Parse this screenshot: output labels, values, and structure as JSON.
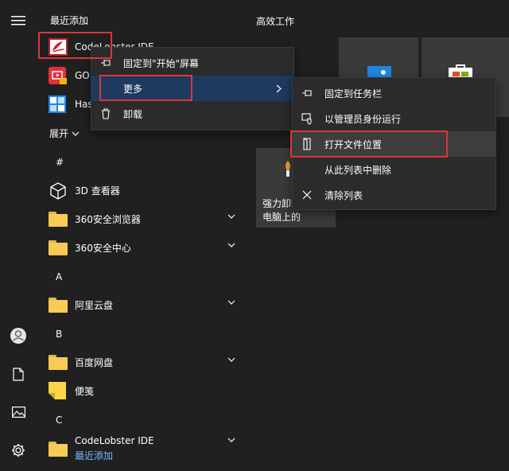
{
  "recent": {
    "title": "最近添加",
    "items": [
      {
        "label": "CodeLobster IDE"
      },
      {
        "label": "GO"
      },
      {
        "label": "Has"
      }
    ]
  },
  "expand_label": "展开",
  "groups": [
    {
      "letter": "#",
      "apps": [
        {
          "label": "3D 查看器"
        },
        {
          "label": "360安全浏览器"
        },
        {
          "label": "360安全中心"
        }
      ]
    },
    {
      "letter": "A",
      "apps": [
        {
          "label": "阿里云盘"
        }
      ]
    },
    {
      "letter": "B",
      "apps": [
        {
          "label": "百度网盘"
        },
        {
          "label": "便笺"
        }
      ]
    },
    {
      "letter": "C",
      "apps": [
        {
          "label": "CodeLobster IDE",
          "sub": "最近添加"
        }
      ]
    }
  ],
  "tiles": {
    "title": "高效工作",
    "tile_label": "强力卸载电脑上的软件"
  },
  "context_menu": {
    "items": [
      "固定到\"开始\"屏幕",
      "更多",
      "卸载"
    ]
  },
  "submenu": {
    "items": [
      "固定到任务栏",
      "以管理员身份运行",
      "打开文件位置",
      "从此列表中删除",
      "清除列表"
    ]
  },
  "colors": {
    "background": "#202020",
    "menu": "#2b2b2b",
    "highlight": "#d9363e",
    "accent": "#1e3a5f",
    "link": "#7ab8ff"
  }
}
